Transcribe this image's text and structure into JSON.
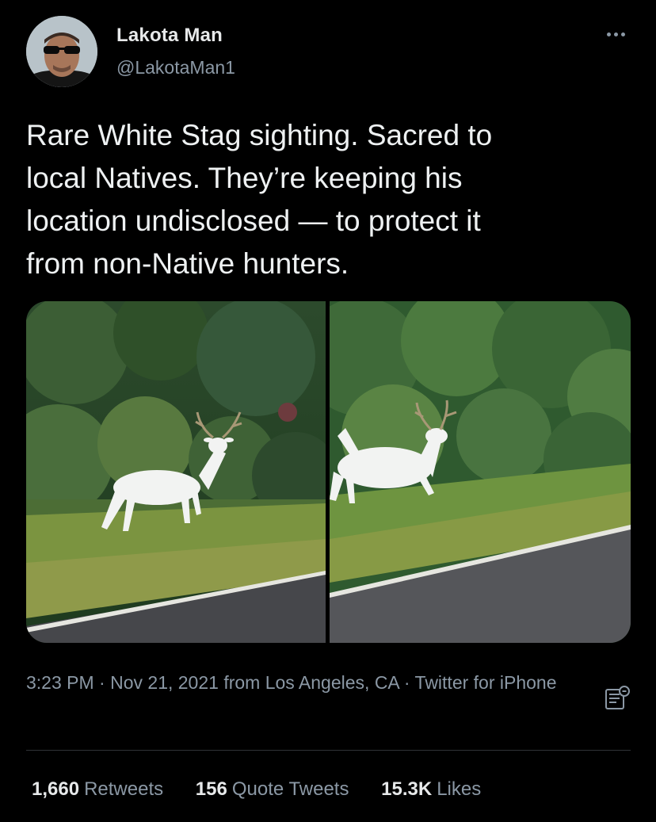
{
  "author": {
    "name": "Lakota Man",
    "handle": "@LakotaMan1"
  },
  "tweet": {
    "text": "Rare White Stag sighting. Sacred to\nlocal Natives. They’re keeping his\nlocation undisclosed — to protect it\nfrom non-Native hunters."
  },
  "meta": {
    "time": "3:23 PM",
    "separator1": " · ",
    "date": "Nov 21, 2021",
    "location": " from Los Angeles, CA",
    "separator2": " · ",
    "client": "Twitter for iPhone"
  },
  "stats": {
    "retweets_count": "1,660",
    "retweets_label": "Retweets",
    "quotes_count": "156",
    "quotes_label": "Quote Tweets",
    "likes_count": "15.3K",
    "likes_label": "Likes"
  },
  "icons": {
    "more": "more-icon",
    "translate": "translate-icon"
  },
  "colors": {
    "background": "#000000",
    "text_primary": "#e7e9ea",
    "text_secondary": "#8b98a5",
    "divider": "#2f3336"
  }
}
